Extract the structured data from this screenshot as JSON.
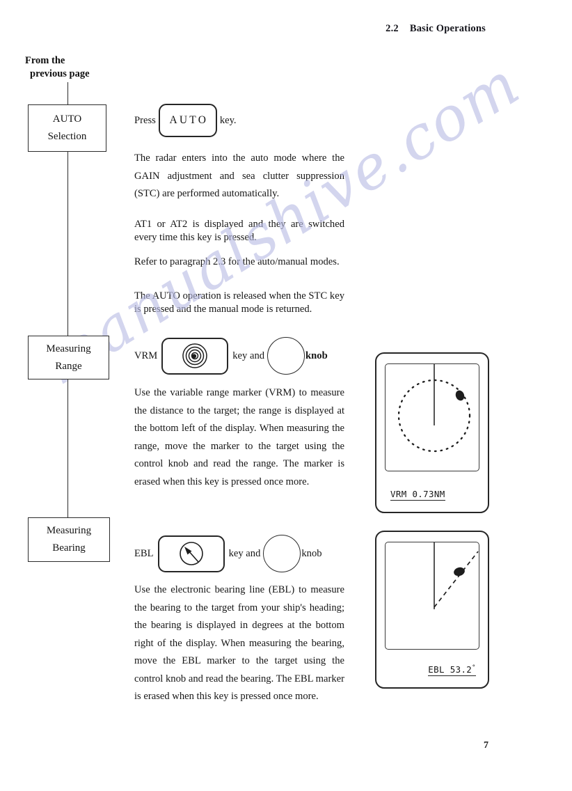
{
  "header": {
    "section_number": "2.2",
    "section_title": "Basic Operations"
  },
  "flow": {
    "caption_line1": "From the",
    "caption_line2": "previous page",
    "boxes": [
      {
        "line1": "AUTO",
        "line2": "Selection"
      },
      {
        "line1": "Measuring",
        "line2": "Range"
      },
      {
        "line1": "Measuring",
        "line2": "Bearing"
      }
    ]
  },
  "auto_section": {
    "press_label": "Press",
    "key_label": "AUTO",
    "key_suffix": "key.",
    "paragraph1": "The radar enters into the auto mode where the GAIN adjustment and sea clutter suppression (STC) are performed automatically.",
    "paragraph2": "AT1 or AT2 is displayed and they are switched every time this key is pressed.",
    "paragraph3": "Refer to paragraph 2.3 for the auto/manual modes.",
    "paragraph4": "The AUTO operation is released when the STC key is pressed and the manual mode is returned."
  },
  "vrm_section": {
    "key_name": "VRM",
    "key_icon": "spiral-icon",
    "middle_label": "key and",
    "knob_label": "knob",
    "paragraph": "Use the variable range marker (VRM) to measure the distance to the target; the range is displayed at the bottom left of the display. When measuring the range, move the marker to the target using the control knob and read the range. The marker is erased when this key is pressed once more."
  },
  "ebl_section": {
    "key_name": "EBL",
    "key_icon": "bearing-cursor-icon",
    "middle_label": "key and",
    "knob_label": "knob",
    "paragraph": "Use the electronic bearing line (EBL) to measure the bearing to the target from your ship's heading; the bearing is displayed in degrees at the bottom right of the display. When measuring the bearing, move the EBL marker to the target using the control knob and read the bearing. The EBL marker is erased when this key is pressed once more."
  },
  "displays": {
    "vrm": {
      "readout": "VRM 0.73NM",
      "readout_value": "0.73",
      "readout_unit": "NM"
    },
    "ebl": {
      "readout_prefix": "EBL 53.2",
      "readout_degree": "°",
      "readout_value": "53.2",
      "readout_unit": "°"
    }
  },
  "watermark": "manualshive.com",
  "page_number": "7"
}
